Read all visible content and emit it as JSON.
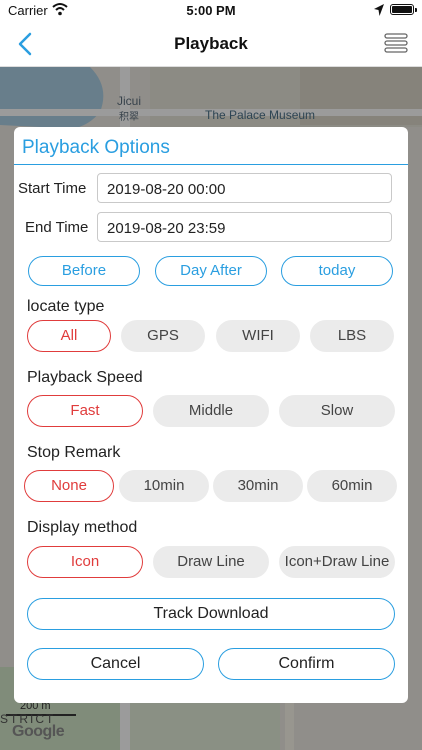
{
  "status": {
    "carrier": "Carrier",
    "time": "5:00 PM"
  },
  "nav": {
    "title": "Playback"
  },
  "map": {
    "labels": {
      "jicui": "Jicui",
      "jicui_cn": "积翠",
      "palace": "The Palace Museum",
      "scale": "200 m",
      "district": "STRICT",
      "google": "Google"
    }
  },
  "dialog": {
    "title": "Playback Options",
    "start_label": "Start Time",
    "start_value": "2019-08-20 00:00",
    "end_label": "End Time",
    "end_value": "2019-08-20 23:59",
    "quick": {
      "before": "Before",
      "day_after": "Day After",
      "today": "today"
    },
    "locate": {
      "label": "locate type",
      "options": [
        "All",
        "GPS",
        "WIFI",
        "LBS"
      ],
      "selected": "All"
    },
    "speed": {
      "label": "Playback Speed",
      "options": [
        "Fast",
        "Middle",
        "Slow"
      ],
      "selected": "Fast"
    },
    "stop": {
      "label": "Stop Remark",
      "options": [
        "None",
        "10min",
        "30min",
        "60min"
      ],
      "selected": "None"
    },
    "display": {
      "label": "Display method",
      "options": [
        "Icon",
        "Draw Line",
        "Icon+Draw Line"
      ],
      "selected": "Icon"
    },
    "track_download": "Track Download",
    "cancel": "Cancel",
    "confirm": "Confirm"
  },
  "colors": {
    "accent": "#2a9ee0",
    "selected": "#e03c3c"
  }
}
